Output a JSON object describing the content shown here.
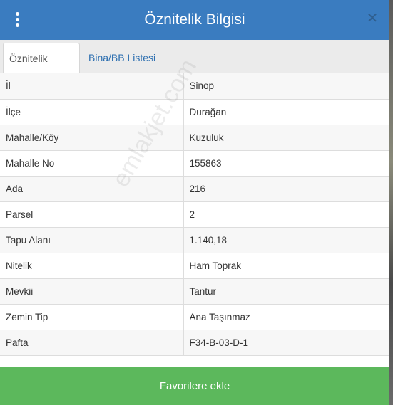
{
  "header": {
    "title": "Öznitelik Bilgisi",
    "menu_icon": "vertical-ellipsis-icon",
    "close_icon": "close-icon",
    "color": "#3a7cc0"
  },
  "tabs": [
    {
      "label": "Öznitelik Bilgisi",
      "active": true
    },
    {
      "label": "Bina/BB Listesi",
      "active": false
    }
  ],
  "attributes": [
    {
      "label": "İl",
      "value": "Sinop"
    },
    {
      "label": "İlçe",
      "value": "Durağan"
    },
    {
      "label": "Mahalle/Köy",
      "value": "Kuzuluk"
    },
    {
      "label": "Mahalle No",
      "value": "155863"
    },
    {
      "label": "Ada",
      "value": "216"
    },
    {
      "label": "Parsel",
      "value": "2"
    },
    {
      "label": "Tapu Alanı",
      "value": "1.140,18"
    },
    {
      "label": "Nitelik",
      "value": "Ham Toprak"
    },
    {
      "label": "Mevkii",
      "value": "Tantur"
    },
    {
      "label": "Zemin Tip",
      "value": "Ana Taşınmaz"
    },
    {
      "label": "Pafta",
      "value": "F34-B-03-D-1"
    }
  ],
  "watermark": "emlakjet.com",
  "footer": {
    "button_label": "Favorilere ekle",
    "color": "#5cb85c"
  }
}
